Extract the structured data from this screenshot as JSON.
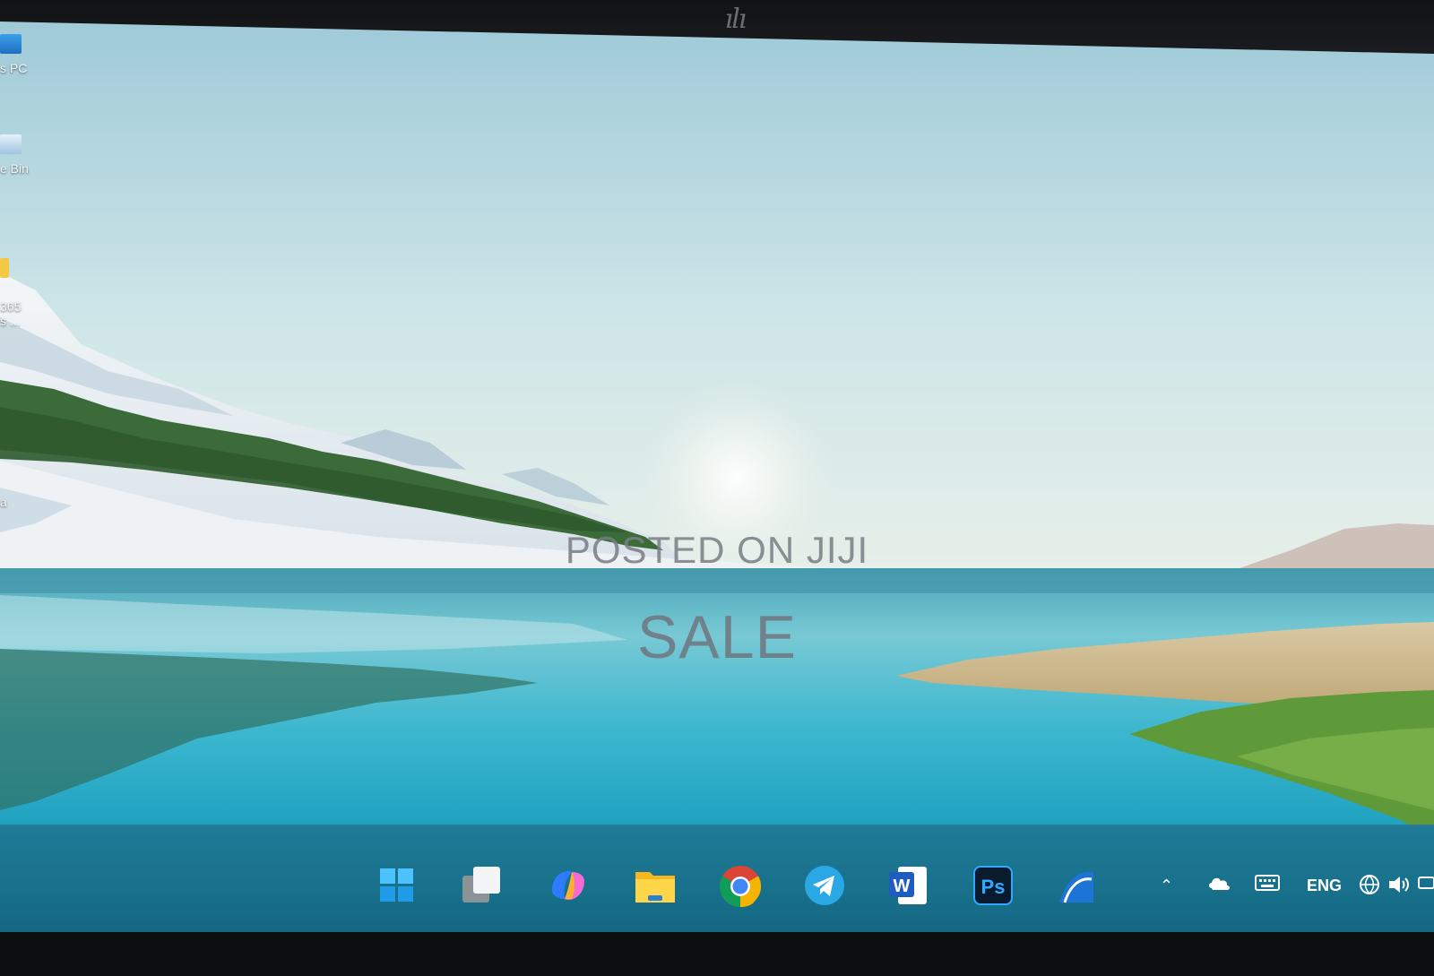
{
  "desktop": {
    "icons": [
      {
        "label": "s PC",
        "icon": "this-pc-icon"
      },
      {
        "label": "e Bin",
        "icon": "recycle-bin-icon"
      },
      {
        "label": "365\ns ...",
        "icon": "folder-icon"
      },
      {
        "label": "a",
        "icon": "app-icon"
      }
    ]
  },
  "watermark": {
    "line1": "POSTED ON JIJI",
    "line2": "SALE"
  },
  "taskbar": {
    "apps": [
      {
        "name": "Start",
        "icon": "windows-start-icon"
      },
      {
        "name": "Task View",
        "icon": "task-view-icon"
      },
      {
        "name": "Copilot",
        "icon": "copilot-icon"
      },
      {
        "name": "File Explorer",
        "icon": "file-explorer-icon"
      },
      {
        "name": "Google Chrome",
        "icon": "chrome-icon"
      },
      {
        "name": "Telegram",
        "icon": "telegram-icon"
      },
      {
        "name": "Microsoft Word",
        "icon": "word-icon"
      },
      {
        "name": "Adobe Photoshop",
        "icon": "photoshop-icon"
      },
      {
        "name": "ArchiCAD",
        "icon": "archicad-icon"
      }
    ],
    "word_glyph": "W",
    "photoshop_glyph": "Ps",
    "tray": {
      "language": "ENG",
      "icons": [
        "chevron-up-icon",
        "onedrive-icon",
        "keyboard-icon",
        "network-icon",
        "volume-icon",
        "battery-icon"
      ]
    }
  },
  "colors": {
    "taskbar": "#1c7591",
    "sky": "#c7e3e8",
    "water": "#35b6ce"
  }
}
